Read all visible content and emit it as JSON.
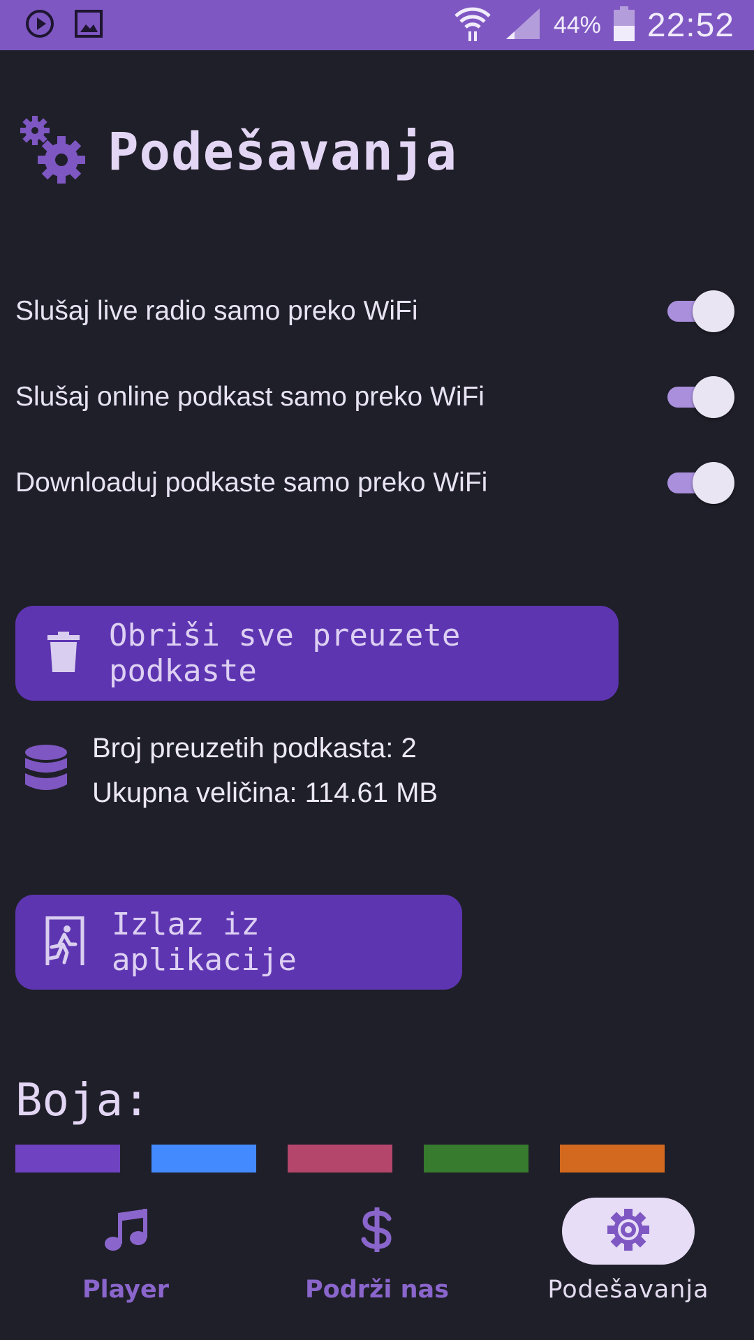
{
  "status_bar": {
    "battery_percent": "44%",
    "time": "22:52",
    "left_icons": [
      "play-circle-icon",
      "image-icon"
    ],
    "right_icons": [
      "wifi-icon",
      "signal-icon",
      "battery-icon"
    ]
  },
  "header": {
    "icon": "gears-icon",
    "title": "Podešavanja"
  },
  "toggles": [
    {
      "label": "Slušaj live radio samo preko WiFi",
      "on": true
    },
    {
      "label": "Slušaj online podkast samo preko WiFi",
      "on": true
    },
    {
      "label": "Downloaduj podkaste samo preko WiFi",
      "on": true
    }
  ],
  "delete_button": {
    "icon": "trash-icon",
    "label": "Obriši sve preuzete podkaste"
  },
  "storage": {
    "icon": "database-icon",
    "count_line": "Broj preuzetih podkasta: 2",
    "size_line": "Ukupna veličina: 114.61 MB"
  },
  "exit_button": {
    "icon": "exit-door-icon",
    "label": "Izlaz iz aplikacije"
  },
  "color_section": {
    "title": "Boja:",
    "swatches": [
      "#6f42c1",
      "#448aff",
      "#b5466b",
      "#367b2e",
      "#d2691e"
    ]
  },
  "nav": {
    "items": [
      {
        "label": "Player",
        "icon": "music-note-icon",
        "active": false
      },
      {
        "label": "Podrži nas",
        "icon": "dollar-icon",
        "active": false
      },
      {
        "label": "Podešavanja",
        "icon": "gear-icon",
        "active": true
      }
    ]
  },
  "colors": {
    "accent": "#7e57c2",
    "button": "#5e35b1",
    "background": "#1f1f29"
  }
}
